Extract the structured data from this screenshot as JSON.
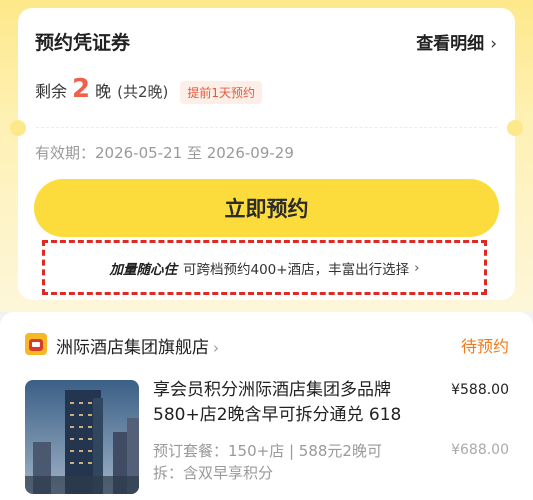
{
  "voucher": {
    "title": "预约凭证券",
    "detail_link": "查看明细",
    "chevron": "›",
    "remain_prefix": "剩余",
    "remain_count": "2",
    "remain_unit": "晚",
    "remain_total": "(共2晚)",
    "advance_tag": "提前1天预约",
    "validity": "有效期：2026-05-21 至 2026-09-29",
    "book_button": "立即预约",
    "promo_highlight": "加量随心住",
    "promo_text": "可跨档预约400+酒店，丰富出行选择"
  },
  "order": {
    "shop_name": "洲际酒店集团旗舰店",
    "shop_chevron": "›",
    "status": "待预约",
    "product_title": "享会员积分洲际酒店集团多品牌580+店2晚含早可拆分通兑 618",
    "price": "¥588.00",
    "package_text": "预订套餐：150+店 | 588元2晚可拆：含双早享积分",
    "original_price": "¥688.00"
  },
  "colors": {
    "brand_yellow": "#fcdc3c",
    "accent_red": "#f0604a",
    "status_orange": "#f07a1a"
  }
}
